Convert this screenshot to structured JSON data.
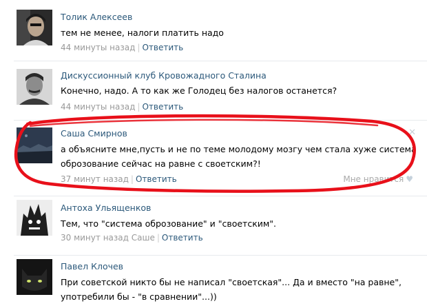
{
  "comments": [
    {
      "author": "Толик Алексеев",
      "text": "тем не менее, налоги платить надо",
      "time": "44 минуты назад",
      "reply": "Ответить"
    },
    {
      "author": "Дискуссионный клуб Кровожадного Сталина",
      "text": "Конечно, надо. А то как же Голодец без налогов останется?",
      "time": "44 минуты назад",
      "reply": "Ответить"
    },
    {
      "author": "Саша Смирнов",
      "text_line1": "а объясните мне,пусть и не по теме молодому мозгу чем стала хуже система",
      "text_line2": "оброзование сейчас на равне с своетским?!",
      "time": "37 минут назад",
      "reply": "Ответить",
      "like": "Мне нравится"
    },
    {
      "author": "Антоха Ульященков",
      "text": "Тем, что \"система оброзование\" и \"своетским\".",
      "time": "30 минут назад",
      "to": "Саше",
      "reply": "Ответить"
    },
    {
      "author": "Павел Клочев",
      "text_line1": "При советской никто бы не написал \"своетская\"... Да и вместо \"на равне\",",
      "text_line2": "употребили бы - \"в сравнении\"...))"
    }
  ],
  "colors": {
    "link": "#2b587a",
    "meta": "#999999",
    "highlight": "#e8101a"
  },
  "icons": {
    "like": "heart-icon",
    "delete": "close-icon"
  }
}
